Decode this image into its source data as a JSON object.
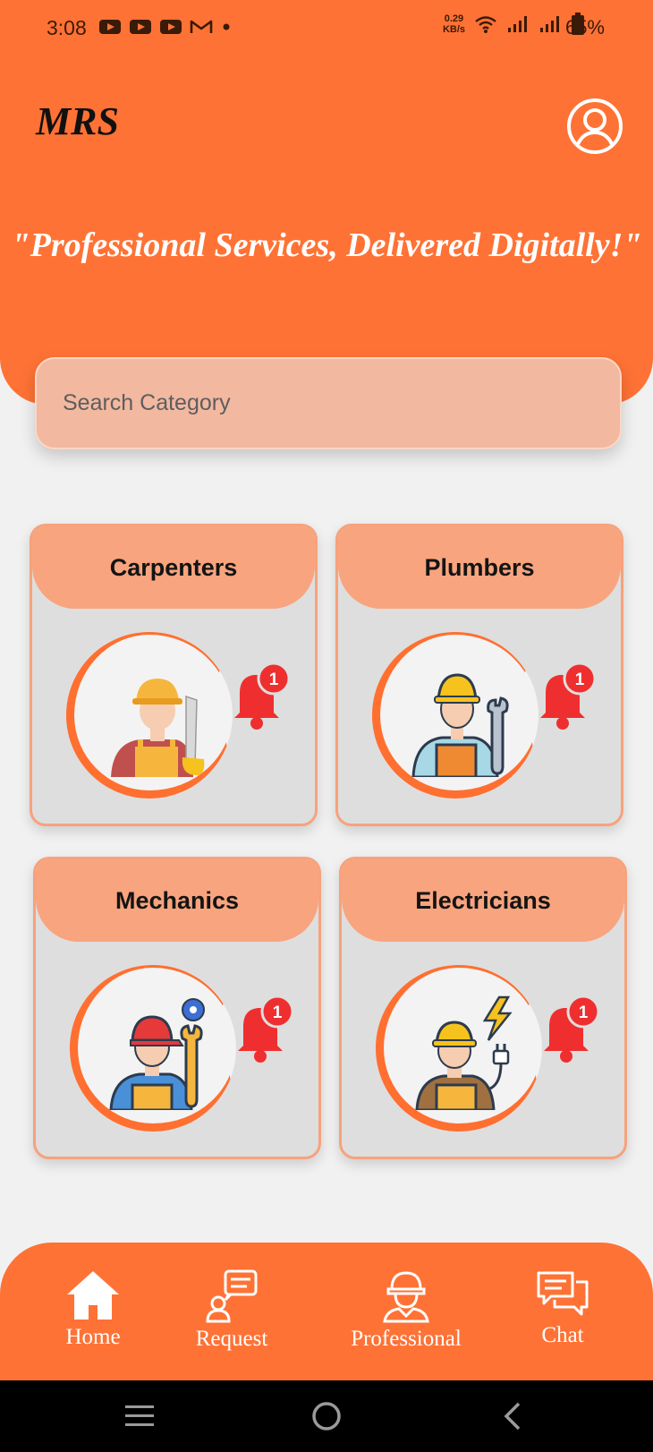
{
  "status_bar": {
    "time": "3:08",
    "net_speed_value": "0.29",
    "net_speed_unit": "KB/s",
    "battery": "65%"
  },
  "header": {
    "app_title": "MRS",
    "tagline": "\"Professional Services, Delivered Digitally!\""
  },
  "search": {
    "placeholder": "Search Category"
  },
  "categories": [
    {
      "name": "Carpenters",
      "badge": "1"
    },
    {
      "name": "Plumbers",
      "badge": "1"
    },
    {
      "name": "Mechanics",
      "badge": "1"
    },
    {
      "name": "Electricians",
      "badge": "1"
    }
  ],
  "bottom_nav": {
    "items": [
      {
        "label": "Home",
        "icon": "home-icon"
      },
      {
        "label": "Request",
        "icon": "request-icon"
      },
      {
        "label": "Professional",
        "icon": "professional-icon"
      },
      {
        "label": "Chat",
        "icon": "chat-icon"
      }
    ]
  },
  "colors": {
    "primary": "#ff7235",
    "card_tab": "#f8a47e",
    "search_bg": "#f2b8a0",
    "bell": "#ef2f2f"
  }
}
